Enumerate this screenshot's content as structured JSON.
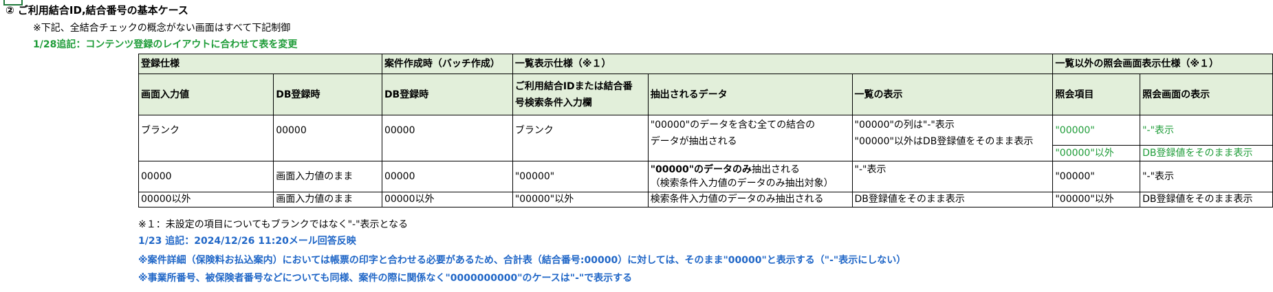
{
  "heading": "② ご利用結合ID,結合番号の基本ケース",
  "note1": "※下記、全結合チェックの概念がない画面はすべて下記制御",
  "green_note": "1/28追記：コンテンツ登録のレイアウトに合わせて表を変更",
  "table": {
    "group_headers": {
      "registration": "登録仕様",
      "batch": "案件作成時（バッチ作成）",
      "list": "一覧表示仕様（※１）",
      "inquiry": "一覧以外の照会画面表示仕様（※１）"
    },
    "col_headers": {
      "screen_input": "画面入力値",
      "db_reg": "DB登録時",
      "db_reg_batch": "DB登録時",
      "search_field_1": "ご利用結合IDまたは結合番",
      "search_field_2": "号検索条件入力欄",
      "extracted": "抽出されるデータ",
      "list_display": "一覧の表示",
      "inquiry_item": "照会項目",
      "inquiry_display": "照会画面の表示"
    },
    "row1": {
      "screen_input": "ブランク",
      "db_reg": "00000",
      "db_reg_batch": "00000",
      "search": "ブランク",
      "extracted_1": "\"00000\"のデータを含む全ての結合の",
      "extracted_2": "データが抽出される",
      "list_display_1": "\"00000\"の列は\"-\"表示",
      "list_display_2": "\"00000\"以外はDB登録値をそのまま表示",
      "inquiry_item_a": "\"00000\"",
      "inquiry_display_a": "\"-\"表示",
      "inquiry_item_b": "\"00000\"以外",
      "inquiry_display_b": "DB登録値をそのまま表示"
    },
    "row2": {
      "screen_input": "00000",
      "db_reg": "画面入力値のまま",
      "db_reg_batch": "00000",
      "search": "\"00000\"",
      "extracted_bold": "\"00000\"のデータのみ",
      "extracted_rest": "抽出される",
      "extracted_2": "（検索条件入力値のデータのみ抽出対象）",
      "list_display": "\"-\"表示",
      "inquiry_item": "\"00000\"",
      "inquiry_display": "\"-\"表示"
    },
    "row3": {
      "screen_input": "00000以外",
      "db_reg": "画面入力値のまま",
      "db_reg_batch": "00000以外",
      "search": "\"00000\"以外",
      "extracted": "検索条件入力値のデータのみ抽出される",
      "list_display": "DB登録値をそのまま表示",
      "inquiry_item": "\"00000\"以外",
      "inquiry_display": "DB登録値をそのまま表示"
    }
  },
  "footnote": "※１：未設定の項目についてもブランクではなく\"-\"表示となる",
  "blue_notes": [
    "1/23 追記：2024/12/26 11:20メール回答反映",
    "※案件詳細（保険料お払込案内）においては帳票の印字と合わせる必要があるため、合計表（結合番号:00000）に対しては、そのまま\"00000\"と表示する（\"-\"表示にしない）",
    "※事業所番号、被保険者番号などについても同様、案件の際に関係なく\"0000000000\"のケースは\"-\"で表示する"
  ],
  "colors": {
    "header_bg": "#e2efda",
    "green_text": "#1e9c38",
    "blue_text": "#1f66c7"
  }
}
